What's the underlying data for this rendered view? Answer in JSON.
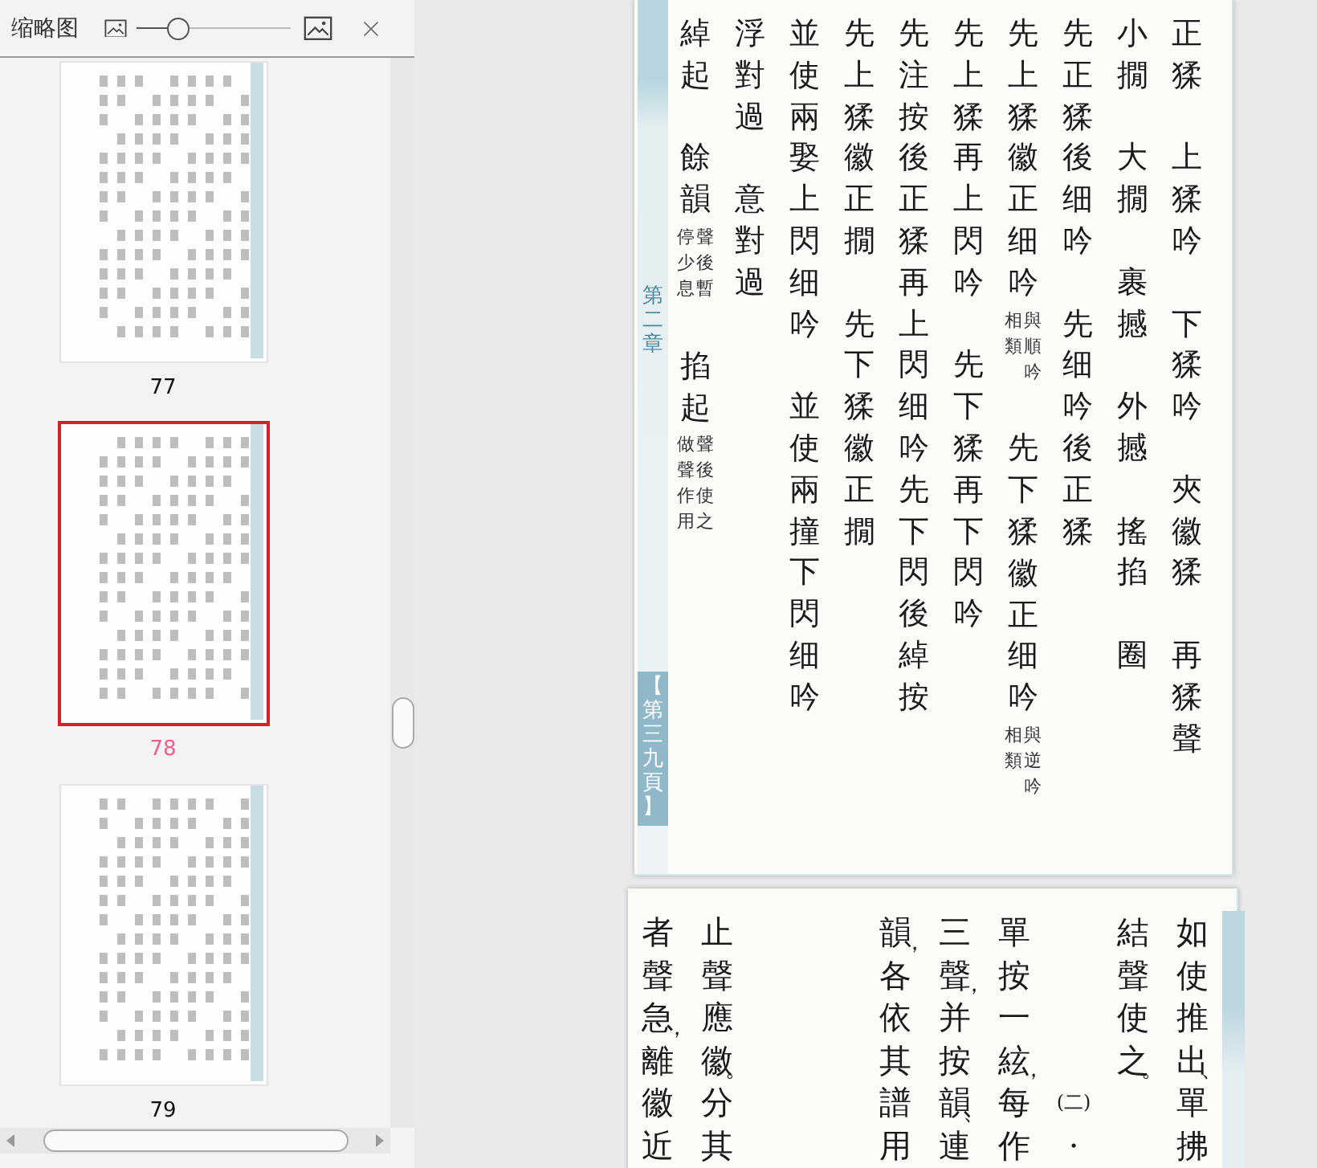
{
  "panel": {
    "title": "缩略图",
    "zoom_slider": {
      "level": 0.27
    },
    "thumbnails": [
      {
        "page": "77",
        "selected": false
      },
      {
        "page": "78",
        "selected": true
      },
      {
        "page": "79",
        "selected": false
      }
    ]
  },
  "pages": [
    {
      "side_labels": [
        {
          "kind": "chapter",
          "text": "第二章"
        },
        {
          "kind": "tab",
          "text": "【第三九頁】"
        }
      ],
      "columns": [
        {
          "kind": "text",
          "segments": [
            {
              "kind": "chars",
              "text": "綽起"
            },
            {
              "kind": "space"
            },
            {
              "kind": "chars",
              "text": "餘韻"
            },
            {
              "kind": "note",
              "lines": [
                "停少息",
                "聲後暫"
              ]
            },
            {
              "kind": "space"
            },
            {
              "kind": "chars",
              "text": "掐起"
            },
            {
              "kind": "note",
              "lines": [
                "做聲作用",
                "聲後使之"
              ]
            }
          ]
        },
        {
          "kind": "text",
          "segments": [
            {
              "kind": "chars",
              "text": "浮對過"
            },
            {
              "kind": "space"
            },
            {
              "kind": "chars",
              "text": "意對過"
            }
          ]
        },
        {
          "kind": "text",
          "segments": [
            {
              "kind": "chars",
              "text": "並使兩娶上閃细吟"
            },
            {
              "kind": "space"
            },
            {
              "kind": "chars",
              "text": "並使兩撞下閃细吟"
            }
          ]
        },
        {
          "kind": "text",
          "segments": [
            {
              "kind": "chars",
              "text": "先上猱徽正撊"
            },
            {
              "kind": "space"
            },
            {
              "kind": "chars",
              "text": "先下猱徽正撊"
            }
          ]
        },
        {
          "kind": "text",
          "segments": [
            {
              "kind": "chars",
              "text": "先注按後正猱再上閃细吟"
            },
            {
              "kind": "chars",
              "text": "先下閃後綽按"
            }
          ]
        },
        {
          "kind": "text",
          "segments": [
            {
              "kind": "chars",
              "text": "先上猱再上閃吟"
            },
            {
              "kind": "space"
            },
            {
              "kind": "chars",
              "text": "先下猱再下閃吟"
            }
          ]
        },
        {
          "kind": "text",
          "segments": [
            {
              "kind": "chars",
              "text": "先上猱徽正细吟"
            },
            {
              "kind": "note",
              "lines": [
                "相類",
                "與順吟"
              ]
            },
            {
              "kind": "space"
            },
            {
              "kind": "chars",
              "text": "先下猱徽正细吟"
            },
            {
              "kind": "note",
              "lines": [
                "相類",
                "與逆吟"
              ]
            }
          ]
        },
        {
          "kind": "text",
          "segments": [
            {
              "kind": "chars",
              "text": "先正猱後细吟"
            },
            {
              "kind": "space"
            },
            {
              "kind": "chars",
              "text": "先细吟後正猱"
            }
          ]
        },
        {
          "kind": "text",
          "segments": [
            {
              "kind": "chars",
              "text": "小撊"
            },
            {
              "kind": "space"
            },
            {
              "kind": "chars",
              "text": "大撊"
            },
            {
              "kind": "space"
            },
            {
              "kind": "chars",
              "text": "裹撼"
            },
            {
              "kind": "space"
            },
            {
              "kind": "chars",
              "text": "外撼"
            },
            {
              "kind": "space"
            },
            {
              "kind": "chars",
              "text": "搖掐"
            },
            {
              "kind": "space"
            },
            {
              "kind": "chars",
              "text": "圈"
            }
          ]
        },
        {
          "kind": "text",
          "segments": [
            {
              "kind": "chars",
              "text": "正猱"
            },
            {
              "kind": "space"
            },
            {
              "kind": "chars",
              "text": "上猱吟"
            },
            {
              "kind": "space"
            },
            {
              "kind": "chars",
              "text": "下猱吟"
            },
            {
              "kind": "space"
            },
            {
              "kind": "chars",
              "text": "夾徽猱"
            },
            {
              "kind": "space"
            },
            {
              "kind": "chars",
              "text": "再猱聲"
            }
          ]
        }
      ]
    },
    {
      "columns": [
        {
          "kind": "text",
          "segments": [
            {
              "kind": "chars",
              "text": "者聲急，離徽近"
            }
          ]
        },
        {
          "kind": "text",
          "segments": [
            {
              "kind": "chars",
              "text": "止聲應徽。分其"
            }
          ]
        },
        {
          "kind": "blank"
        },
        {
          "kind": "blank"
        },
        {
          "kind": "text",
          "segments": [
            {
              "kind": "chars",
              "text": "韻，各依其譜用"
            }
          ]
        },
        {
          "kind": "text",
          "segments": [
            {
              "kind": "chars",
              "text": "三聲，并按韻、連"
            }
          ]
        },
        {
          "kind": "text",
          "segments": [
            {
              "kind": "chars",
              "text": "單按一絃，每作"
            }
          ]
        },
        {
          "kind": "text",
          "segments": [
            {
              "kind": "space"
            },
            {
              "kind": "space"
            },
            {
              "kind": "space"
            },
            {
              "kind": "space"
            },
            {
              "kind": "label",
              "text": "(二)"
            },
            {
              "kind": "chars",
              "text": "·"
            }
          ]
        },
        {
          "kind": "text",
          "segments": [
            {
              "kind": "chars",
              "text": "結聲使之。"
            }
          ]
        },
        {
          "kind": "text",
          "segments": [
            {
              "kind": "chars",
              "text": "如使推出、單拂"
            }
          ]
        }
      ]
    }
  ]
}
